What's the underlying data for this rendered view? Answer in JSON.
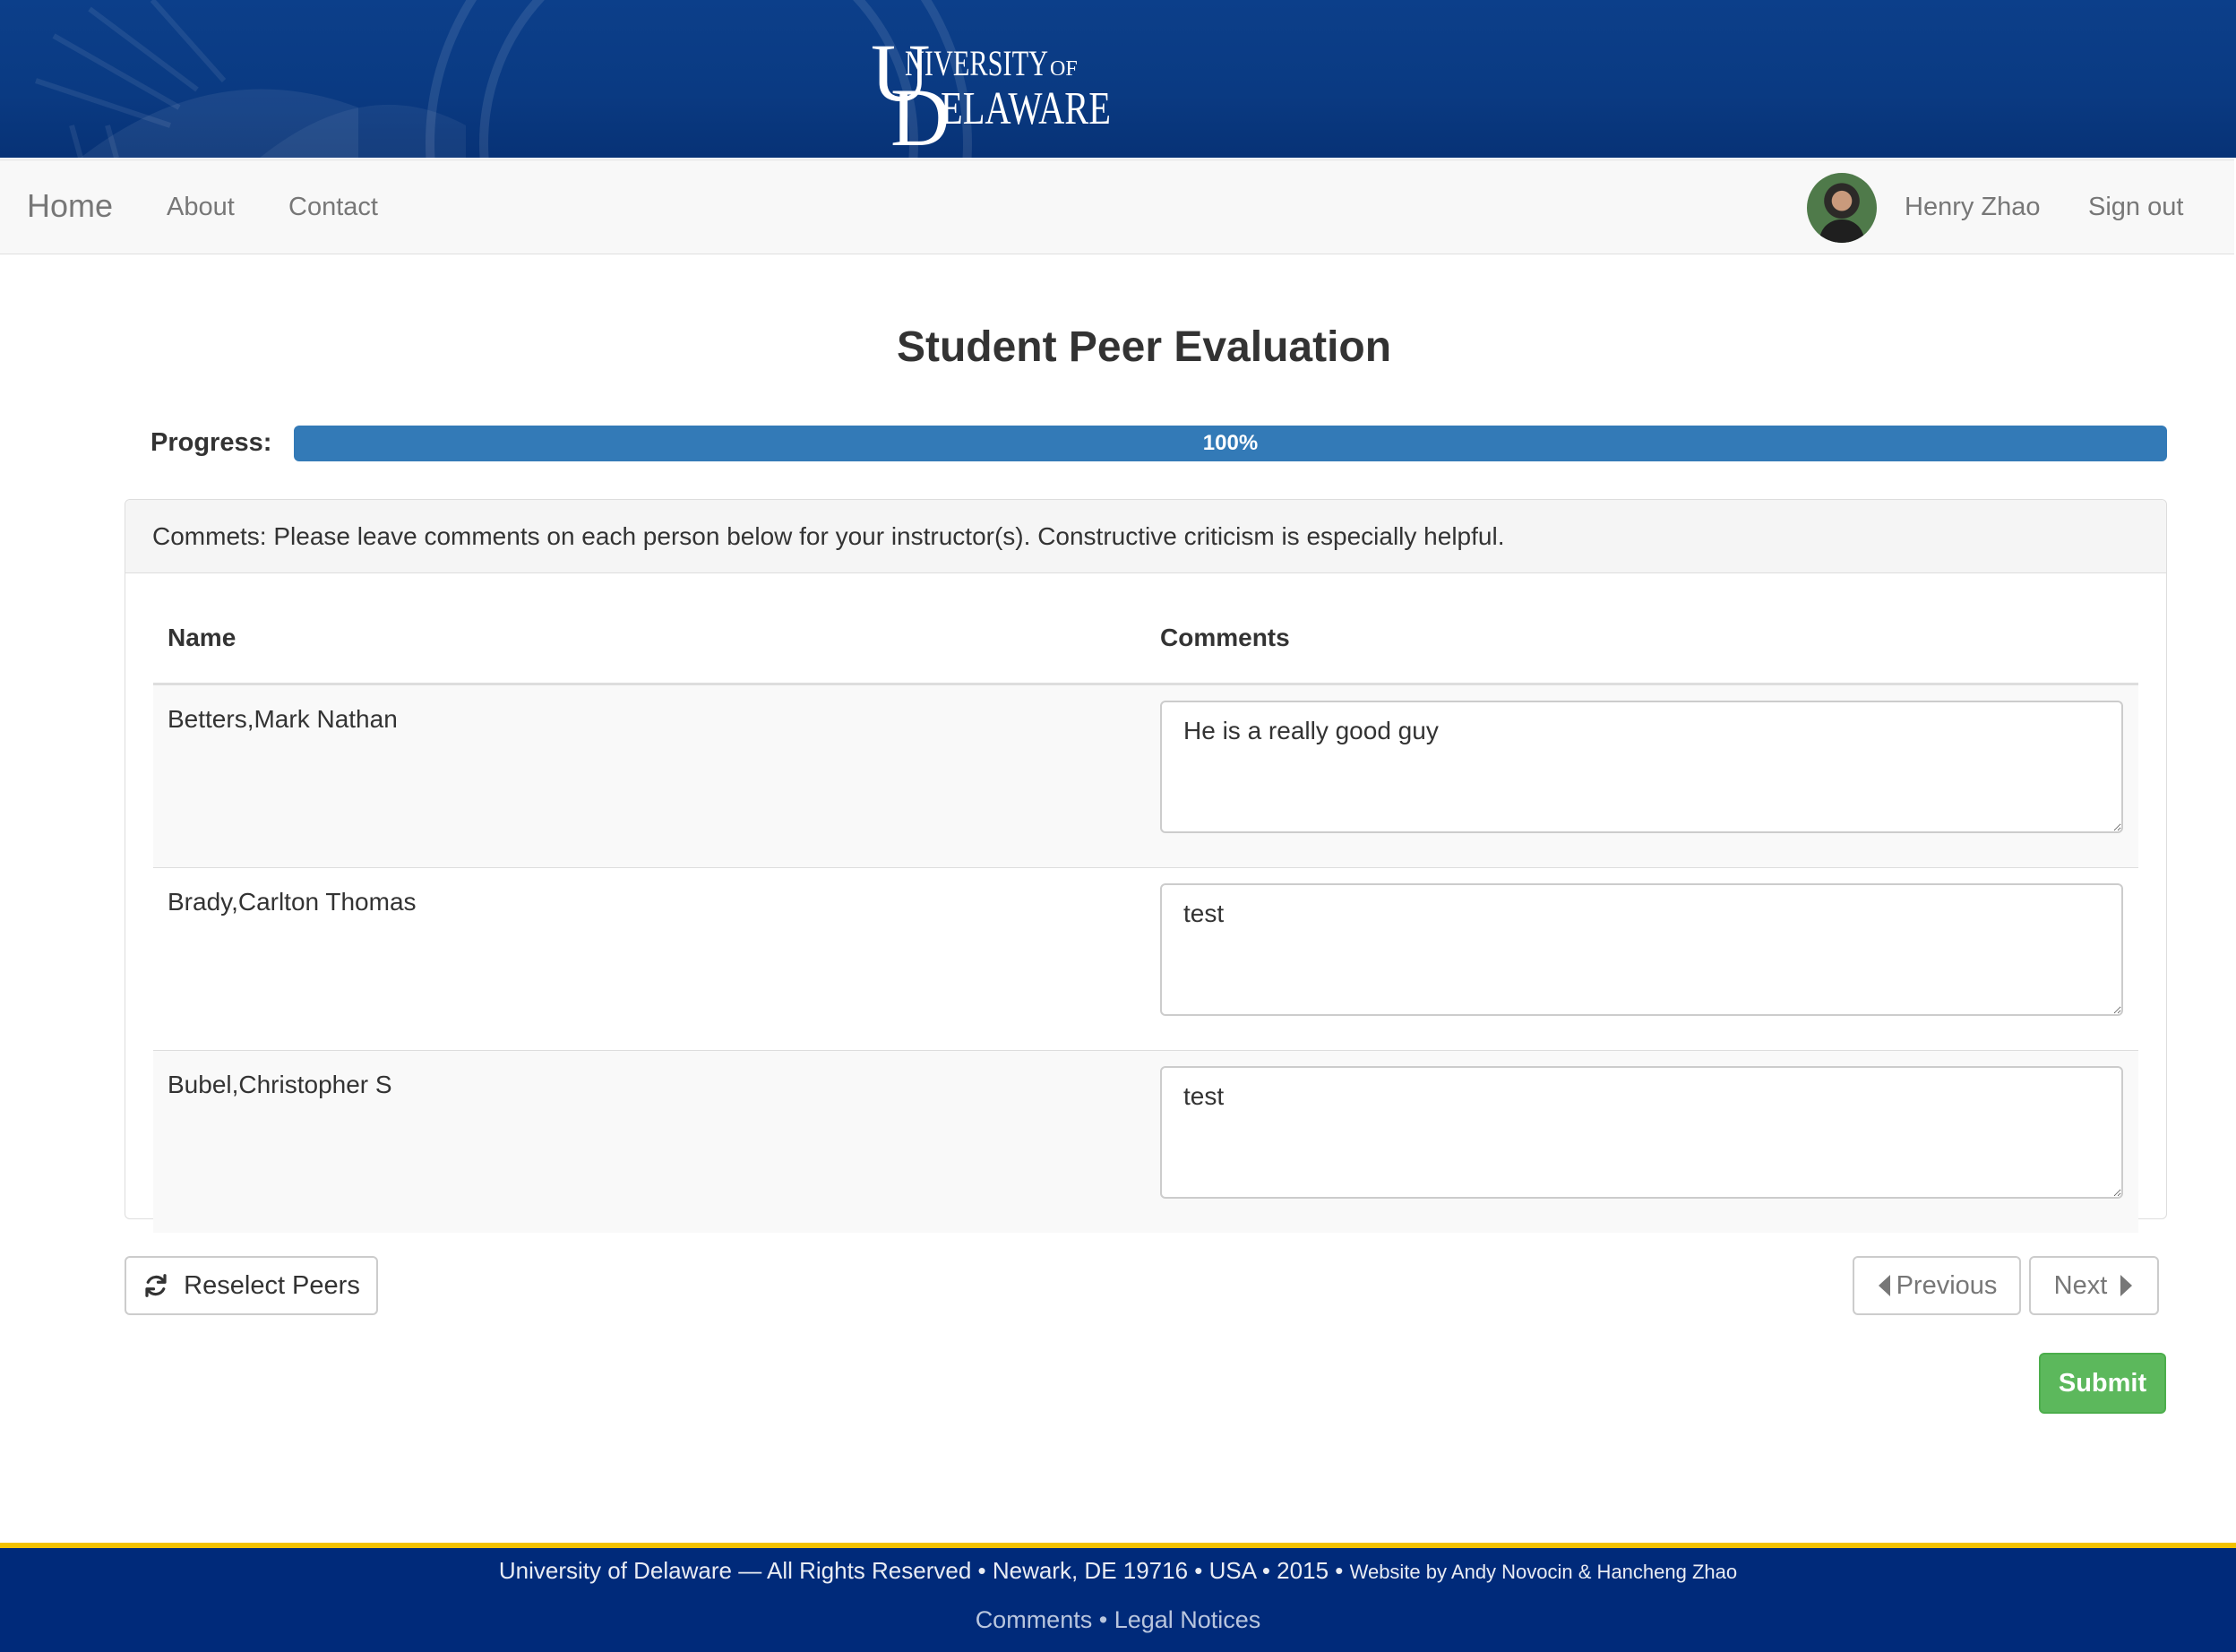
{
  "header": {
    "logo_alt": "University of Delaware",
    "logo_line1": "NIVERSITY",
    "logo_of": "OF",
    "logo_line2": "ELAWARE"
  },
  "navbar": {
    "brand": "Home",
    "links": [
      "About",
      "Contact"
    ],
    "user_name": "Henry Zhao",
    "sign_out": "Sign out"
  },
  "page": {
    "title": "Student Peer Evaluation",
    "progress_label": "Progress:",
    "progress_percent": 100,
    "progress_text": "100%"
  },
  "panel": {
    "heading": "Commets: Please leave comments on each person below for your instructor(s). Constructive criticism is especially helpful.",
    "columns": {
      "name": "Name",
      "comments": "Comments"
    },
    "rows": [
      {
        "name": "Betters,Mark Nathan",
        "comment": "He is a really good guy"
      },
      {
        "name": "Brady,Carlton Thomas",
        "comment": "test"
      },
      {
        "name": "Bubel,Christopher S",
        "comment": "test"
      }
    ]
  },
  "buttons": {
    "reselect": "Reselect Peers",
    "previous": "Previous",
    "next": "Next",
    "submit": "Submit"
  },
  "footer": {
    "line1": "University of Delaware — All Rights Reserved • Newark, DE 19716 • USA • 2015 •",
    "credit": "Website by Andy Novocin & Hancheng Zhao",
    "comments_link": "Comments",
    "separator": "•",
    "legal_link": "Legal Notices"
  },
  "colors": {
    "banner": "#0a3a82",
    "progress": "#337ab7",
    "submit": "#5cb85c",
    "footer": "#002a7a",
    "footer_border": "#f2c200"
  },
  "icons": {
    "reselect": "refresh-icon",
    "previous": "triangle-left-icon",
    "next": "triangle-right-icon"
  }
}
